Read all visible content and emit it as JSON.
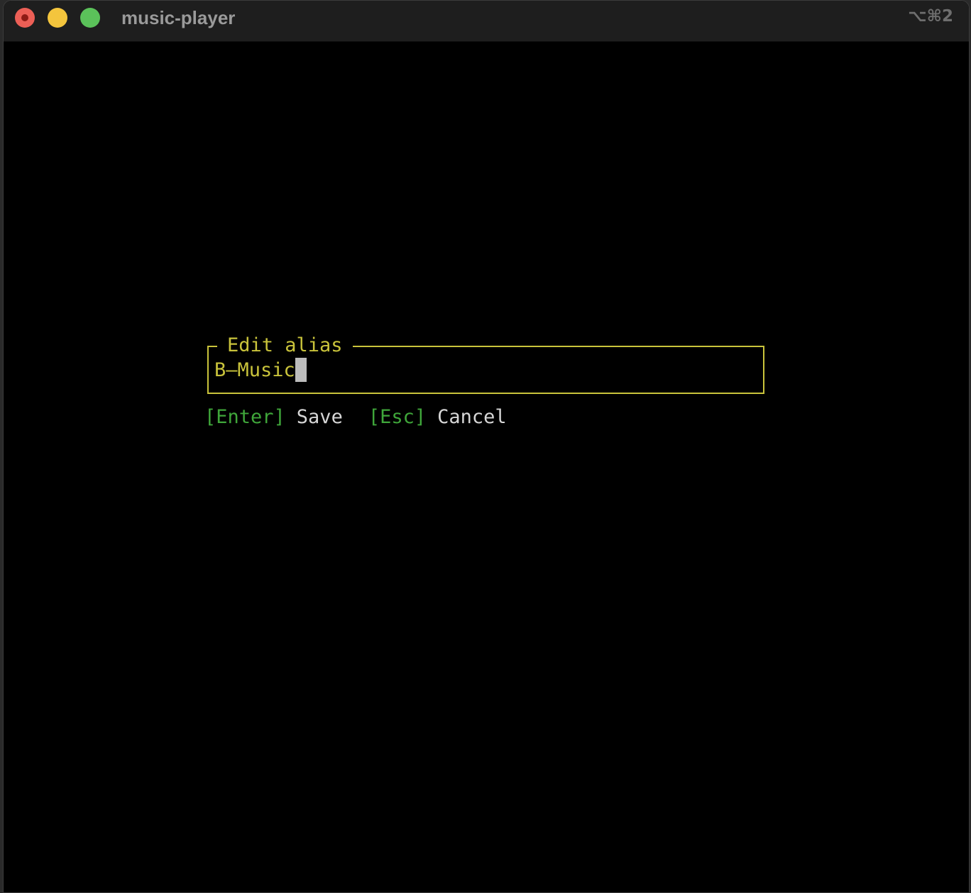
{
  "window": {
    "title": "music-player",
    "shortcut": "⌥⌘2"
  },
  "dialog": {
    "title": "Edit alias",
    "value": "B—Music"
  },
  "hints": {
    "save_key": "[Enter]",
    "save_label": "Save",
    "cancel_key": "[Esc]",
    "cancel_label": "Cancel"
  },
  "colors": {
    "background": "#000000",
    "dialog_accent": "#c9c33b",
    "key_color": "#3fa63a",
    "text": "#d6d6d6"
  }
}
